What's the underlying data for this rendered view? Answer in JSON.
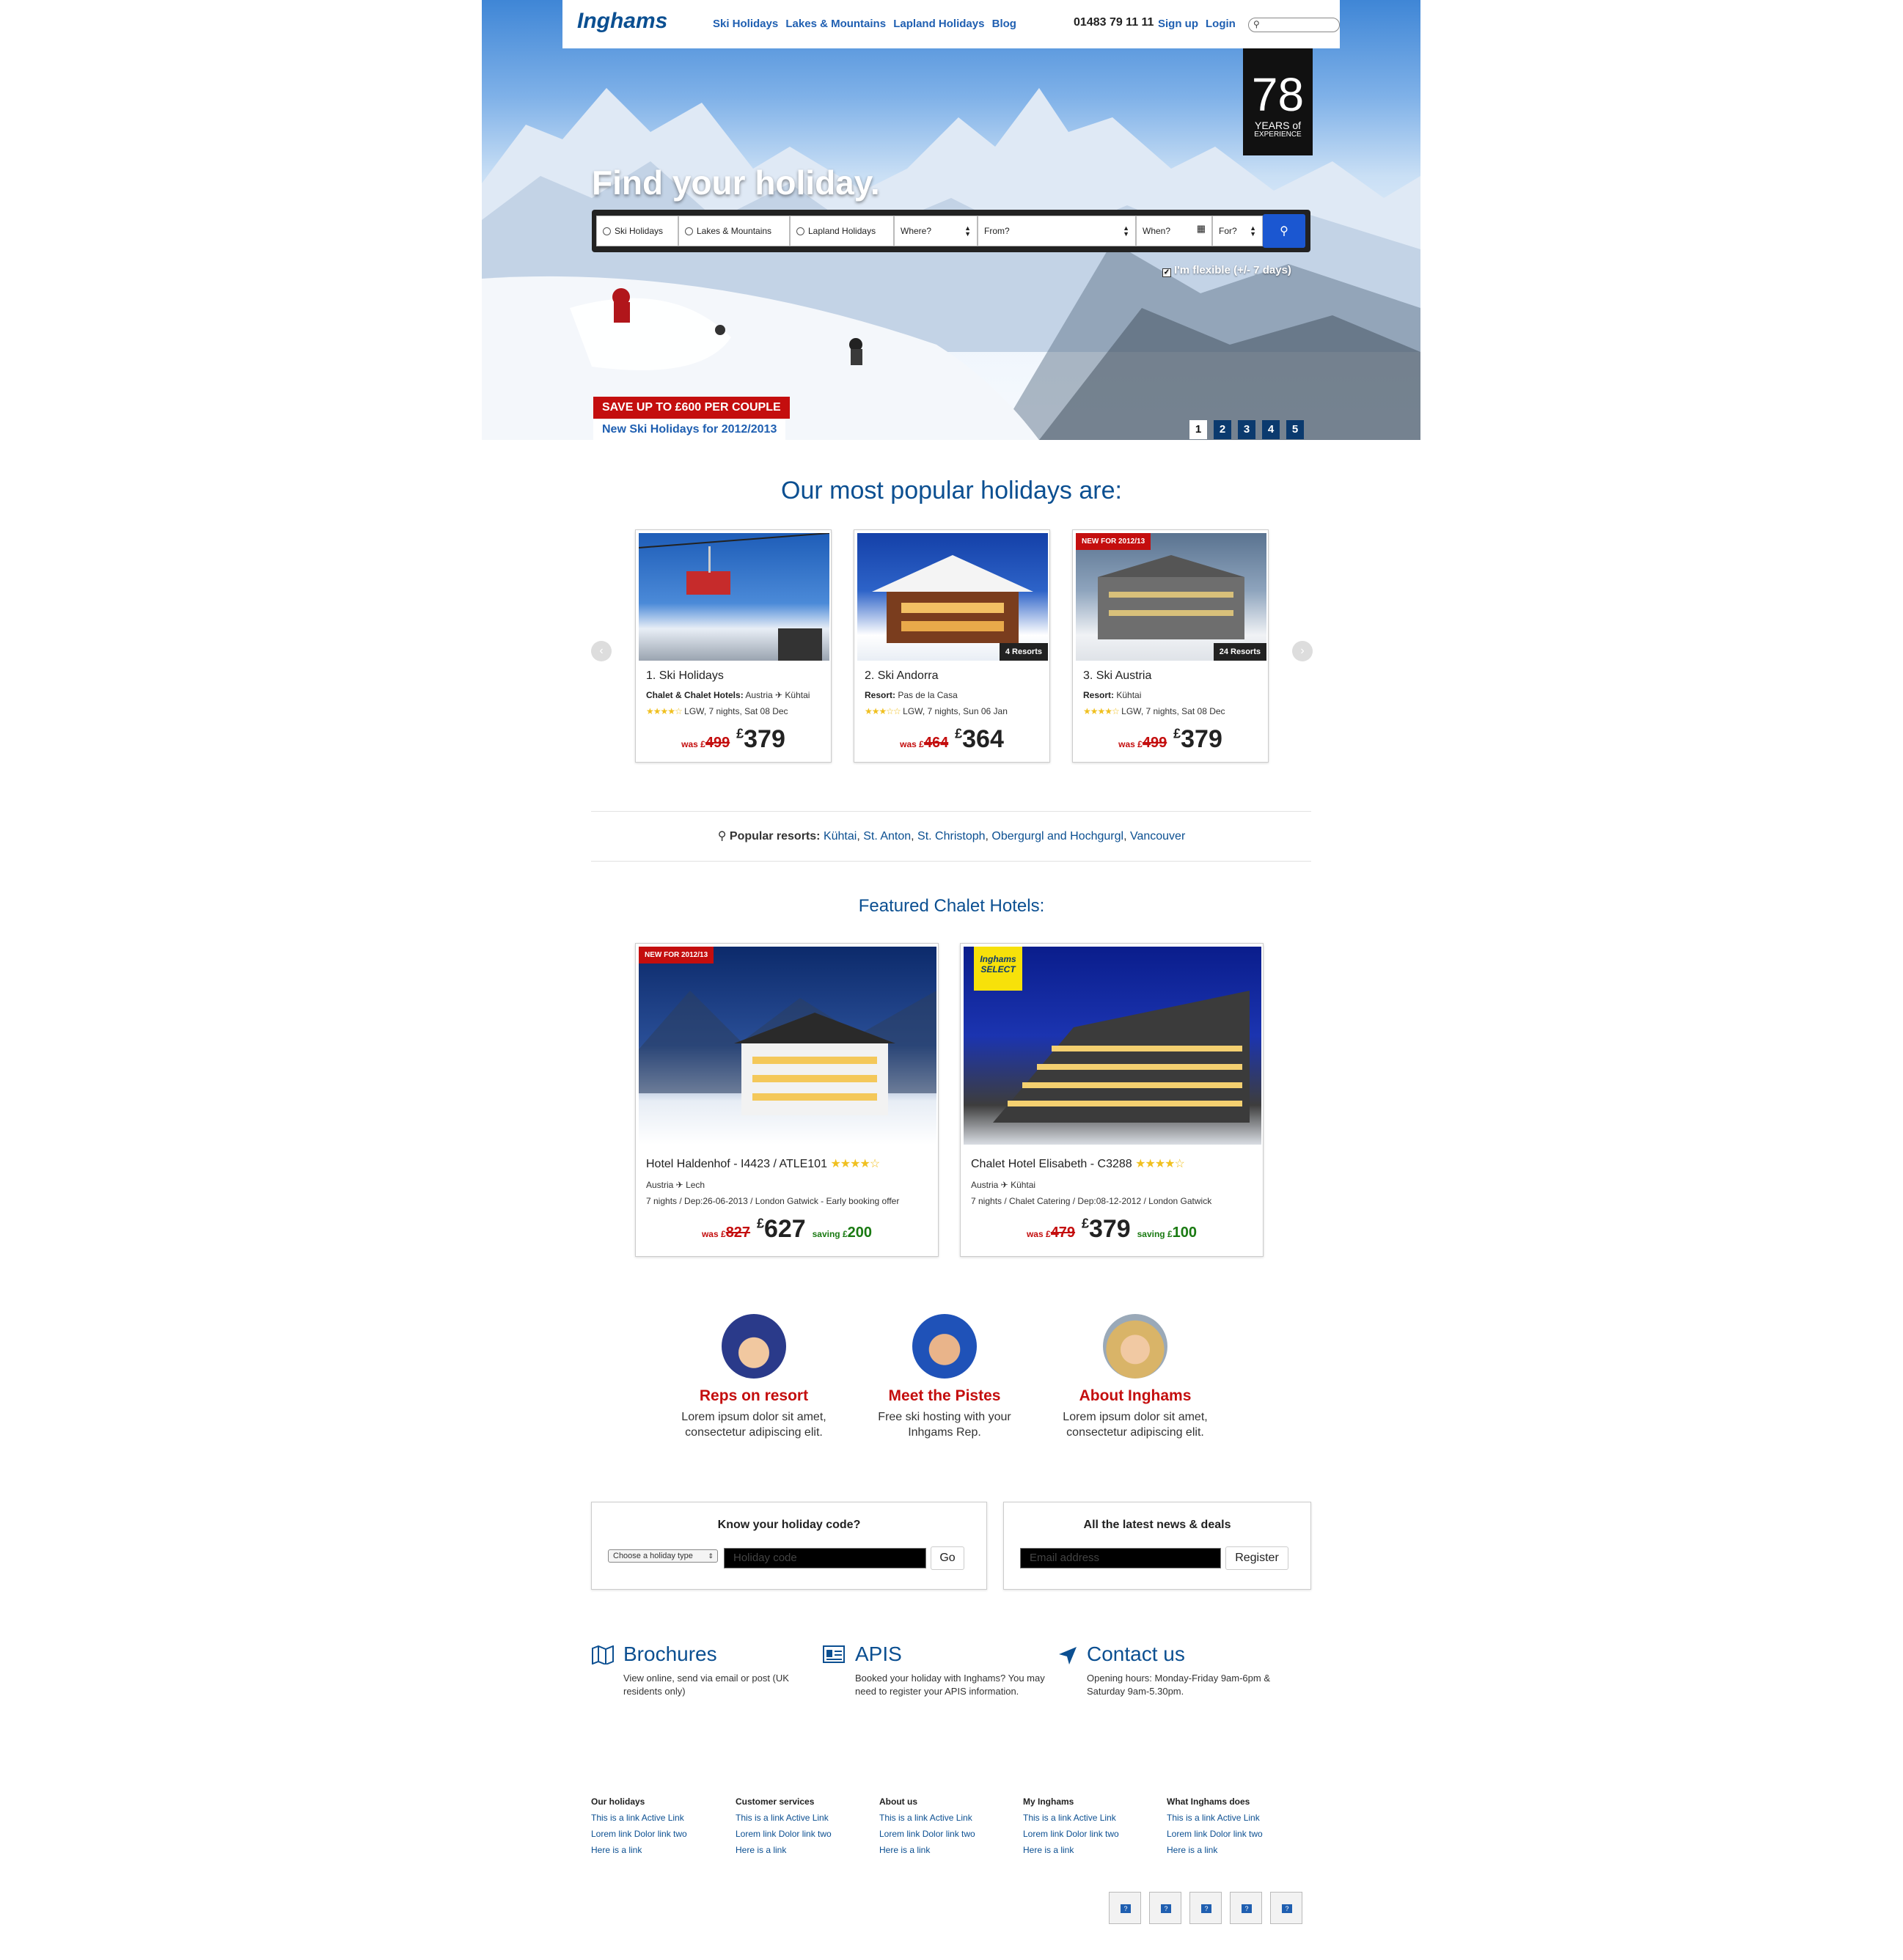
{
  "header": {
    "logo": "Inghams",
    "nav": [
      "Ski Holidays",
      "Lakes & Mountains",
      "Lapland Holidays",
      "Blog"
    ],
    "phone": "01483 79 11 11",
    "signup": "Sign up",
    "login": "Login"
  },
  "hero": {
    "badge_number": "78",
    "badge_line1": "YEARS of",
    "badge_line2": "EXPERIENCE",
    "title": "Find your holiday.",
    "search_options": [
      "Ski Holidays",
      "Lakes & Mountains",
      "Lapland Holidays"
    ],
    "where": "Where?",
    "from": "From?",
    "when": "When?",
    "for": "For?",
    "flexible": "I'm flexible (+/- 7 days)",
    "promo_red": "SAVE UP TO £600 PER COUPLE",
    "promo_blue": "New Ski Holidays for 2012/2013",
    "pages": [
      "1",
      "2",
      "3",
      "4",
      "5"
    ]
  },
  "popular": {
    "title": "Our most popular holidays are:",
    "cards": [
      {
        "title": "1. Ski Holidays",
        "label": "Chalet & Chalet Hotels:",
        "detail": "Austria ✈ Kühtai",
        "stars": "★★★★☆",
        "info": "LGW, 7 nights, Sat 08 Dec",
        "was_prefix": "was",
        "currency": "£",
        "was": "499",
        "price": "379",
        "tag": "",
        "resorts": ""
      },
      {
        "title": "2. Ski Andorra",
        "label": "Resort:",
        "detail": "Pas de la Casa",
        "stars": "★★★☆☆",
        "info": "LGW, 7 nights, Sun 06 Jan",
        "was_prefix": "was",
        "currency": "£",
        "was": "464",
        "price": "364",
        "tag": "",
        "resorts": "4 Resorts"
      },
      {
        "title": "3. Ski Austria",
        "label": "Resort:",
        "detail": "Kühtai",
        "stars": "★★★★☆",
        "info": "LGW, 7 nights, Sat 08 Dec",
        "was_prefix": "was",
        "currency": "£",
        "was": "499",
        "price": "379",
        "tag": "NEW FOR 2012/13",
        "resorts": "24 Resorts"
      }
    ],
    "resorts_label": "Popular resorts:",
    "resorts": [
      "Kühtai",
      "St. Anton",
      "St. Christoph",
      "Obergurgl and Hochgurgl",
      "Vancouver"
    ]
  },
  "chalets": {
    "title": "Featured Chalet Hotels:",
    "cards": [
      {
        "tag": "NEW FOR 2012/13",
        "title": "Hotel Haldenhof - I4423 / ATLE101",
        "stars": "★★★★☆",
        "route": "Austria ✈ Lech",
        "info": "7 nights / Dep:26-06-2013 / London Gatwick - Early booking offer",
        "was_prefix": "was",
        "currency": "£",
        "was": "827",
        "price": "627",
        "saving_prefix": "saving",
        "saving": "200"
      },
      {
        "tag": "Inghams SELECT",
        "title": "Chalet Hotel Elisabeth - C3288",
        "stars": "★★★★☆",
        "route": "Austria ✈ Kühtai",
        "info": "7 nights / Chalet Catering / Dep:08-12-2012 / London Gatwick",
        "was_prefix": "was",
        "currency": "£",
        "was": "479",
        "price": "379",
        "saving_prefix": "saving",
        "saving": "100"
      }
    ]
  },
  "features": [
    {
      "title": "Reps on resort",
      "line1": "Lorem ipsum dolor sit amet,",
      "line2": "consectetur adipiscing elit."
    },
    {
      "title": "Meet the Pistes",
      "line1": "Free ski hosting with your",
      "line2": "Inhgams Rep."
    },
    {
      "title": "About Inghams",
      "line1": "Lorem ipsum dolor sit amet,",
      "line2": "consectetur adipiscing elit."
    }
  ],
  "holiday_code": {
    "title": "Know your holiday code?",
    "select": "Choose a holiday type",
    "placeholder": "Holiday code",
    "button": "Go"
  },
  "newsletter": {
    "title": "All the latest news & deals",
    "placeholder": "Email address",
    "button": "Register"
  },
  "info": [
    {
      "title": "Brochures",
      "line1": "View online, send via email or post (UK",
      "line2": "residents only)"
    },
    {
      "title": "APIS",
      "line1": "Booked your holiday with Inghams? You may",
      "line2": "need to register your APIS information."
    },
    {
      "title": "Contact us",
      "line1": "Opening hours: Monday-Friday 9am-6pm &",
      "line2": "Saturday 9am-5.30pm."
    }
  ],
  "footer": [
    {
      "head": "Our holidays",
      "l1": "This is a link",
      "l1b": "Active Link",
      "l2": "Lorem link",
      "l2b": "Dolor link two",
      "l3": "Here is a link"
    },
    {
      "head": "Customer services",
      "l1": "This is a link",
      "l1b": "Active Link",
      "l2": "Lorem link",
      "l2b": "Dolor link two",
      "l3": "Here is a link"
    },
    {
      "head": "About us",
      "l1": "This is a link",
      "l1b": "Active Link",
      "l2": "Lorem link",
      "l2b": "Dolor link two",
      "l3": "Here is a link"
    },
    {
      "head": "My Inghams",
      "l1": "This is a link",
      "l1b": "Active Link",
      "l2": "Lorem link",
      "l2b": "Dolor link two",
      "l3": "Here is a link"
    },
    {
      "head": "What Inghams does",
      "l1": "This is a link",
      "l1b": "Active Link",
      "l2": "Lorem link",
      "l2b": "Dolor link two",
      "l3": "Here is a link"
    }
  ],
  "social_count_label": "?"
}
